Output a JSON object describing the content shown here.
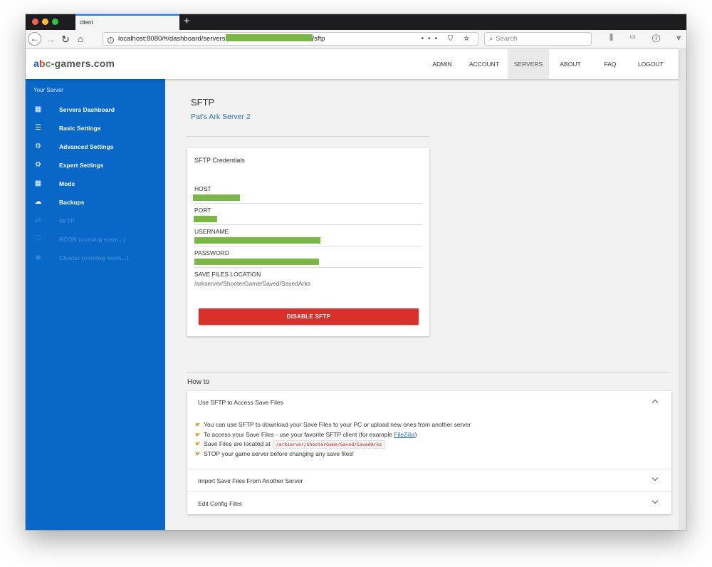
{
  "browser": {
    "tab_title": "client",
    "new_tab": "+",
    "url_prefix": "localhost:8080/#/dashboard/servers",
    "url_suffix": "/sftp",
    "url_actions": "••• ⛉ ☆",
    "search_placeholder": "Search",
    "toolbar_icons": "⫼ ▭ ⓘ ⩔ ≡"
  },
  "header": {
    "logo": {
      "a": "a",
      "b": "b",
      "c": "c",
      "rest": "-gamers.com"
    },
    "nav": [
      {
        "label": "ADMIN"
      },
      {
        "label": "ACCOUNT"
      },
      {
        "label": "SERVERS"
      },
      {
        "label": "ABOUT"
      },
      {
        "label": "FAQ"
      },
      {
        "label": "LOGOUT"
      }
    ]
  },
  "sidebar": {
    "header": "Your Server",
    "items": [
      {
        "label": "Servers Dashboard",
        "icon": "dashboard-icon",
        "glyph": "▦"
      },
      {
        "label": "Basic Settings",
        "icon": "list-icon",
        "glyph": "☰"
      },
      {
        "label": "Advanced Settings",
        "icon": "gear-icon",
        "glyph": "⚙"
      },
      {
        "label": "Expert Settings",
        "icon": "expert-gear-icon",
        "glyph": "⚙"
      },
      {
        "label": "Mods",
        "icon": "grid-icon",
        "glyph": "▦"
      },
      {
        "label": "Backups",
        "icon": "cloud-upload-icon",
        "glyph": "☁"
      },
      {
        "label": "SFTP",
        "icon": "transfer-icon",
        "glyph": "⇄"
      },
      {
        "label": "RCON (coming soon...)",
        "icon": "shield-icon",
        "glyph": "⛉"
      },
      {
        "label": "Cluster (coming soon...)",
        "icon": "cluster-icon",
        "glyph": "◉"
      }
    ]
  },
  "main": {
    "title": "SFTP",
    "server_name": "Pat's Ark Server 2",
    "card": {
      "title": "SFTP Credentials",
      "host_label": "HOST",
      "port_label": "PORT",
      "username_label": "USERNAME",
      "password_label": "PASSWORD",
      "save_location_label": "SAVE FILES LOCATION",
      "save_location_value": "/arkserver/ShooterGame/Saved/SavedArks",
      "disable_button": "DISABLE SFTP"
    },
    "howto": {
      "title": "How to",
      "items": [
        {
          "title": "Use SFTP to Access Save Files",
          "lines": {
            "l1": "You can use SFTP to download your Save Files to your PC or upload new ones from another server",
            "l2a": "To access your Save Files - use your favorite SFTP client (for example ",
            "l2link": "FileZilla",
            "l2b": ")",
            "l3a": "Save Files are located at",
            "l3code": "/arkserver/ShooterGame/Saved/SavedArks",
            "l4": "STOP your game server before changing any save files!"
          }
        },
        {
          "title": "Import Save Files From Another Server"
        },
        {
          "title": "Edit Config Files"
        }
      ],
      "hand_glyph": "☛"
    }
  },
  "colors": {
    "sidebar_bg": "#0867c7",
    "accent_link": "#1a73b8",
    "danger_button": "#d9302a",
    "redaction": "#78b843"
  }
}
